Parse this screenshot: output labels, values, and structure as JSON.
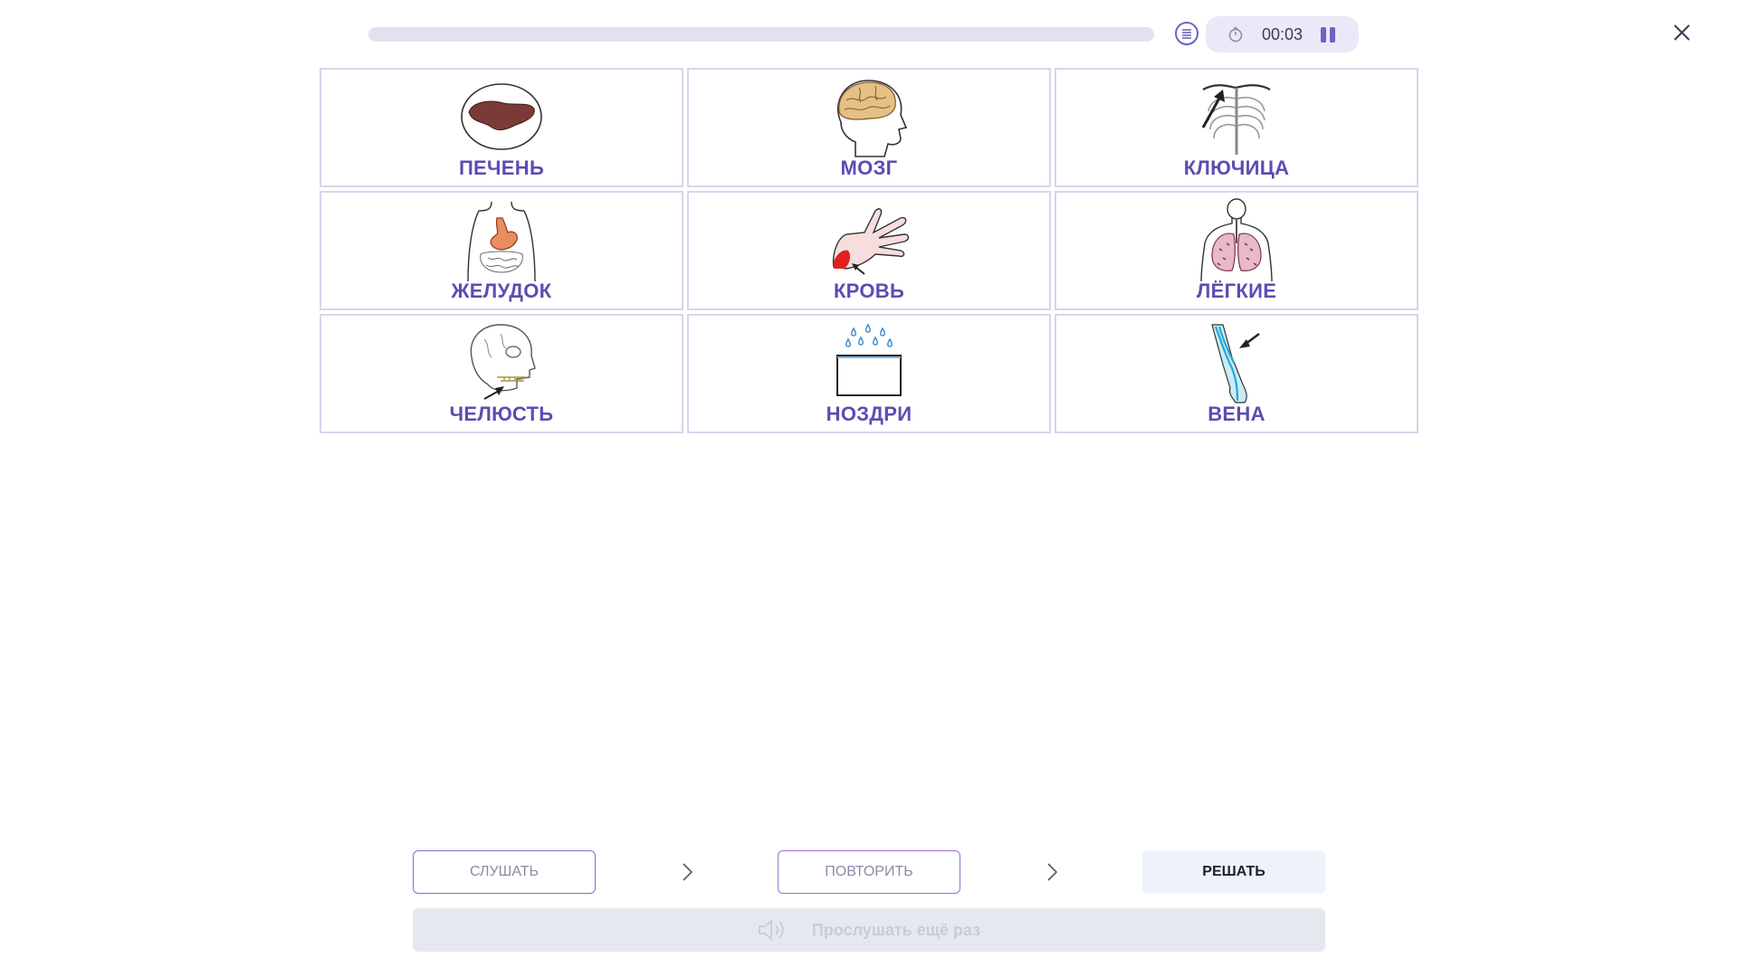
{
  "header": {
    "progress_fraction": 0,
    "timer": "00:03",
    "icons": [
      "list-icon",
      "stopwatch-icon",
      "pause-icon",
      "close-icon"
    ]
  },
  "cards": [
    {
      "label": "ПЕЧЕНЬ",
      "icon": "liver-icon"
    },
    {
      "label": "МОЗГ",
      "icon": "brain-icon"
    },
    {
      "label": "КЛЮЧИЦА",
      "icon": "collarbone-icon"
    },
    {
      "label": "ЖЕЛУДОК",
      "icon": "stomach-icon"
    },
    {
      "label": "КРОВЬ",
      "icon": "blood-icon"
    },
    {
      "label": "ЛЁГКИЕ",
      "icon": "lungs-icon"
    },
    {
      "label": "ЧЕЛЮСТЬ",
      "icon": "jaw-icon"
    },
    {
      "label": "НОЗДРИ",
      "icon": "nostrils-icon"
    },
    {
      "label": "ВЕНА",
      "icon": "vein-icon"
    }
  ],
  "controls": {
    "listen_label": "СЛУШАТЬ",
    "repeat_label": "ПОВТОРИТЬ",
    "solve_label": "РЕШАТЬ",
    "replay_label": "Прослушать ещё раз"
  },
  "colors": {
    "accent": "#5a4db3",
    "cell_border": "#d8d5ec",
    "timer_bg": "#ebe9f7",
    "solve_bg": "#edf2fb",
    "replay_bg": "#e6e8ef"
  }
}
